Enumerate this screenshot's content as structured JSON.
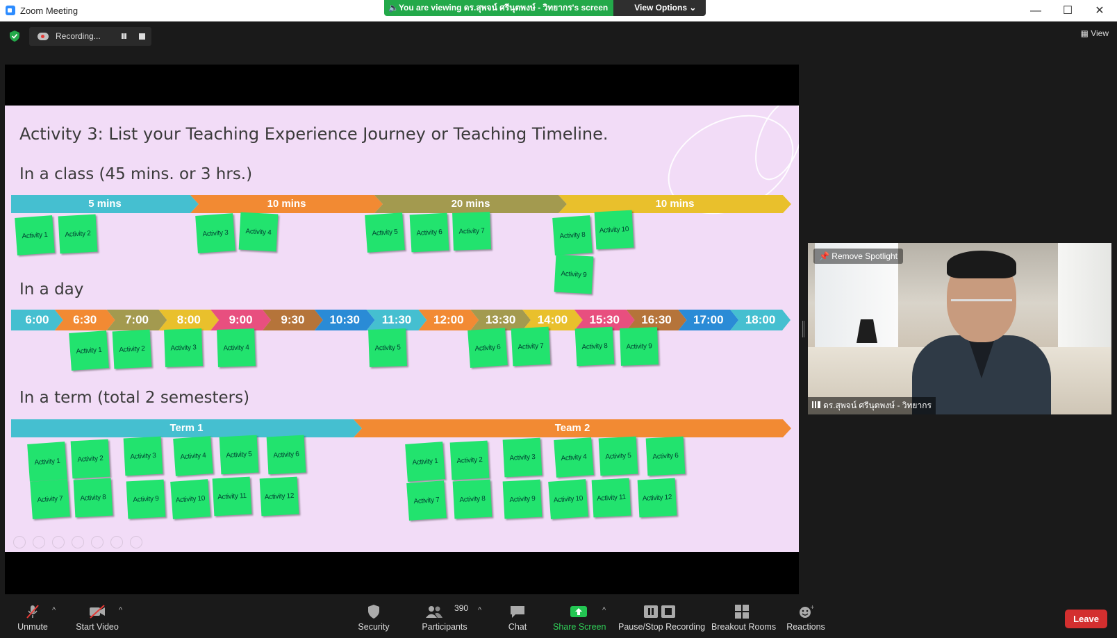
{
  "window": {
    "title": "Zoom Meeting",
    "minimize": "—",
    "maximize": "☐",
    "close": "✕"
  },
  "viewing": {
    "message": "🔈You are viewing ดร.สุพจน์ ศรีนุตพงษ์ - วิทยากร's screen",
    "options": "View Options ⌄"
  },
  "recording": {
    "status": "Recording...",
    "encryption_icon": "shield-check-icon"
  },
  "view_button": "▦ View",
  "slide": {
    "title": "Activity 3: List your Teaching Experience Journey or Teaching Timeline.",
    "section_class": "In a class (45 mins. or 3 hrs.)",
    "section_day": "In a day",
    "section_term": "In a term (total 2 semesters)",
    "class_segments": [
      {
        "label": "5 mins",
        "color": "#45bfd0"
      },
      {
        "label": "10 mins",
        "color": "#f28a33"
      },
      {
        "label": "20 mins",
        "color": "#a39a4f"
      },
      {
        "label": "10 mins",
        "color": "#e9c02c"
      }
    ],
    "day_times": [
      {
        "label": "6:00",
        "color": "#45bfd0"
      },
      {
        "label": "6:30",
        "color": "#f28a33"
      },
      {
        "label": "7:00",
        "color": "#a39a4f"
      },
      {
        "label": "8:00",
        "color": "#e9c02c"
      },
      {
        "label": "9:00",
        "color": "#e84f7f"
      },
      {
        "label": "9:30",
        "color": "#b5743a"
      },
      {
        "label": "10:30",
        "color": "#2a8bd6"
      },
      {
        "label": "11:30",
        "color": "#45bfd0"
      },
      {
        "label": "12:00",
        "color": "#f28a33"
      },
      {
        "label": "13:30",
        "color": "#a39a4f"
      },
      {
        "label": "14:00",
        "color": "#e9c02c"
      },
      {
        "label": "15:30",
        "color": "#e84f7f"
      },
      {
        "label": "16:30",
        "color": "#b5743a"
      },
      {
        "label": "17:00",
        "color": "#2a8bd6"
      },
      {
        "label": "18:00",
        "color": "#45bfd0"
      }
    ],
    "terms": [
      {
        "label": "Term 1",
        "color": "#45bfd0"
      },
      {
        "label": "Team 2",
        "color": "#f28a33"
      }
    ],
    "class_notes": [
      "Activity 1",
      "Activity 2",
      "Activity 3",
      "Activity 4",
      "Activity 5",
      "Activity 6",
      "Activity 7",
      "Activity 8",
      "Activity 10",
      "Activity 9"
    ],
    "day_notes": [
      "Activity 1",
      "Activity 2",
      "Activity 3",
      "Activity 4",
      "Activity 5",
      "Activity 6",
      "Activity 7",
      "Activity 8",
      "Activity 9"
    ],
    "term1_notes": [
      "Activity 1",
      "Activity 2",
      "Activity 3",
      "Activity 4",
      "Activity 5",
      "Activity 6",
      "Activity 7",
      "Activity 8",
      "Activity 9",
      "Activity 10",
      "Activity 11",
      "Activity 12"
    ],
    "term2_notes": [
      "Activity 1",
      "Activity 2",
      "Activity 3",
      "Activity 4",
      "Activity 5",
      "Activity 6",
      "Activity 7",
      "Activity 8",
      "Activity 9",
      "Activity 10",
      "Activity 11",
      "Activity 12"
    ]
  },
  "video": {
    "spotlight": "Remove Spotlight",
    "name": "ดร.สุพจน์ ศรีนุตพงษ์ - วิทยากร"
  },
  "toolbar": {
    "unmute": "Unmute",
    "start_video": "Start Video",
    "security": "Security",
    "participants": "Participants",
    "participants_count": "390",
    "chat": "Chat",
    "share_screen": "Share Screen",
    "pause_stop_recording": "Pause/Stop Recording",
    "breakout_rooms": "Breakout Rooms",
    "reactions": "Reactions",
    "leave": "Leave"
  }
}
